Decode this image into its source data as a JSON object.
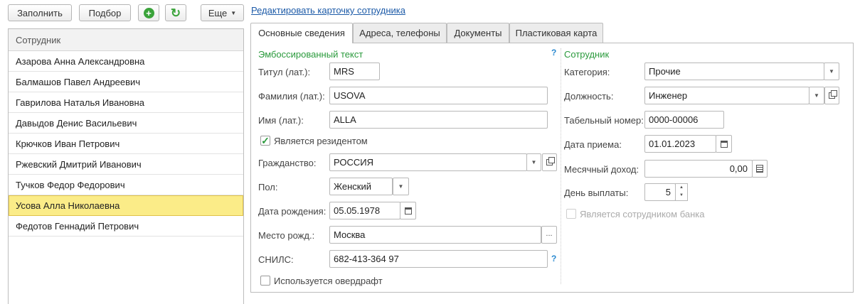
{
  "toolbar": {
    "fill_label": "Заполнить",
    "select_label": "Подбор",
    "more_label": "Еще"
  },
  "icons": {
    "add": "plus-circle-icon",
    "refresh": "refresh-icon",
    "accent_green": "#3aa33a"
  },
  "employees": {
    "header": "Сотрудник",
    "rows": [
      "Азарова Анна Александровна",
      "Балмашов Павел Андреевич",
      "Гаврилова Наталья Ивановна",
      "Давыдов Денис Васильевич",
      "Крючков Иван Петрович",
      "Ржевский Дмитрий Иванович",
      "Тучков Федор Федорович",
      "Усова Алла Николаевна",
      "Федотов Геннадий Петрович"
    ],
    "selected_index": 7
  },
  "card": {
    "edit_link": "Редактировать карточку сотрудника",
    "tabs": [
      "Основные сведения",
      "Адреса, телефоны",
      "Документы",
      "Пластиковая карта"
    ],
    "active_tab": 0
  },
  "embossed": {
    "section_title": "Эмбоссированный текст",
    "help": "?",
    "title_label": "Титул (лат.):",
    "title_value": "MRS",
    "surname_label": "Фамилия (лат.):",
    "surname_value": "USOVA",
    "name_label": "Имя (лат.):",
    "name_value": "ALLA",
    "resident_label": "Является резидентом",
    "resident_checked": true,
    "citizenship_label": "Гражданство:",
    "citizenship_value": "РОССИЯ",
    "gender_label": "Пол:",
    "gender_value": "Женский",
    "birthdate_label": "Дата рождения:",
    "birthdate_value": "05.05.1978",
    "birthplace_label": "Место рожд.:",
    "birthplace_value": "Москва",
    "snils_label": "СНИЛС:",
    "snils_value": "682-413-364 97",
    "snils_help": "?",
    "overdraft_label": "Используется овердрафт",
    "overdraft_checked": false
  },
  "employee": {
    "section_title": "Сотрудник",
    "category_label": "Категория:",
    "category_value": "Прочие",
    "position_label": "Должность:",
    "position_value": "Инженер",
    "tabnum_label": "Табельный номер:",
    "tabnum_value": "0000-00006",
    "hiredate_label": "Дата приема:",
    "hiredate_value": "01.01.2023",
    "income_label": "Месячный доход:",
    "income_value": "0,00",
    "payday_label": "День выплаты:",
    "payday_value": "5",
    "bank_employee_label": "Является сотрудником банка",
    "bank_employee_checked": false
  }
}
